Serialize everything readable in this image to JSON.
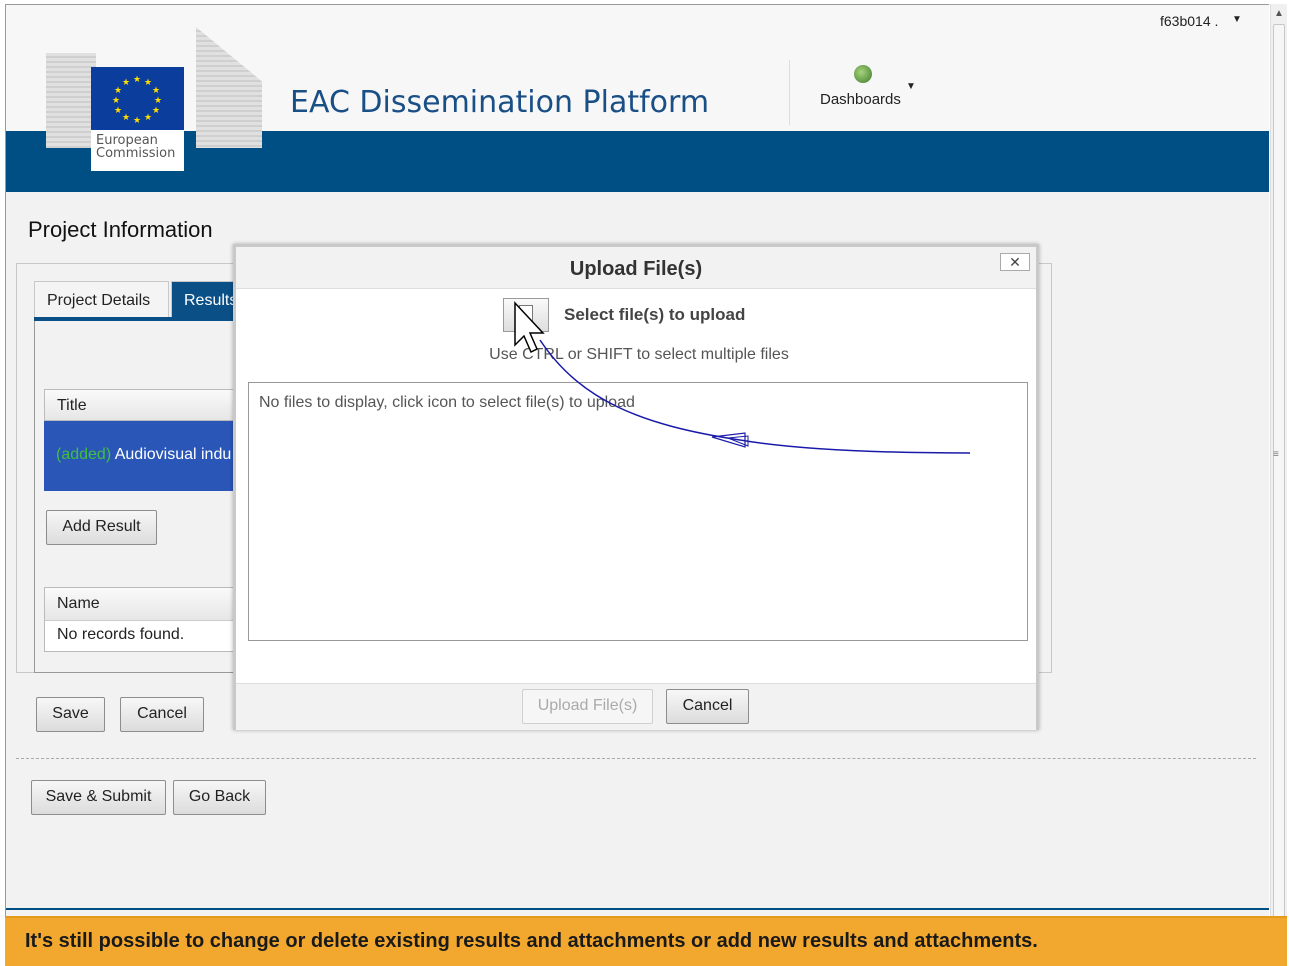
{
  "header": {
    "logo_line1": "European",
    "logo_line2": "Commission",
    "app_title": "EAC Dissemination Platform",
    "dashboards_label": "Dashboards",
    "username": "f63b014 ."
  },
  "page": {
    "title": "Project Information",
    "tabs": [
      {
        "label": "Project Details"
      },
      {
        "label": "Results"
      }
    ],
    "results_grid": {
      "column_title": "Title",
      "row": {
        "tag": "(added)",
        "text": "Audiovisual indu"
      }
    },
    "add_result_label": "Add Result",
    "attachments_grid": {
      "column_name": "Name",
      "empty_text": "No records found."
    },
    "save_label": "Save",
    "cancel_label": "Cancel",
    "save_submit_label": "Save & Submit",
    "go_back_label": "Go Back"
  },
  "modal": {
    "title": "Upload File(s)",
    "close_glyph": "✕",
    "select_label": "Select file(s) to upload",
    "hint": "Use CTRL or SHIFT to select multiple files",
    "empty_text": "No files to display, click icon to select file(s) to upload",
    "upload_label": "Upload File(s)",
    "cancel_label": "Cancel"
  },
  "banner": {
    "text": "It's still possible to change or delete existing results and attachments or add new results and attachments."
  },
  "icons": [
    "eu-flag-logo",
    "globe-icon",
    "caret-down-icon",
    "file-upload-icon",
    "close-icon",
    "cursor-icon",
    "annotation-arrow"
  ],
  "colors": {
    "brand_blue": "#004f84",
    "title_blue": "#1a4f86",
    "selected_row": "#2a56b8",
    "banner": "#f2a82e",
    "arrow": "#1a1aa8"
  }
}
